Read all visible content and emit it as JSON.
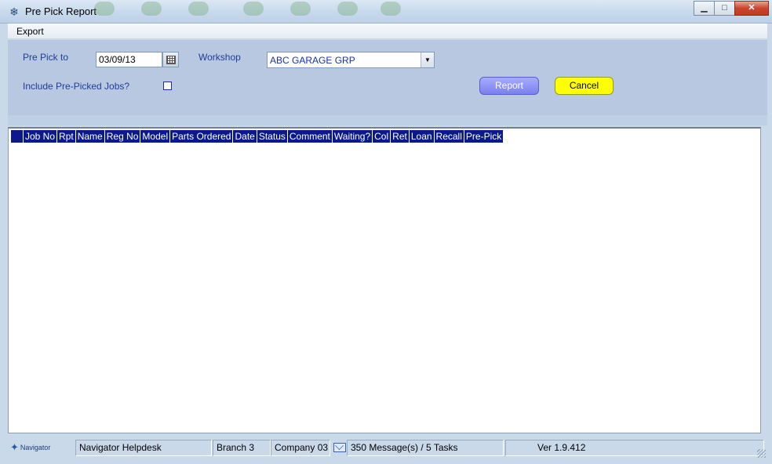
{
  "window": {
    "title": "Pre Pick Report",
    "app_icon": "snowflake-icon",
    "controls": {
      "minimize": "▁",
      "maximize": "□",
      "close": "✕"
    }
  },
  "menu": {
    "items": [
      {
        "label": "Export"
      }
    ]
  },
  "filters": {
    "pre_pick_label": "Pre Pick to",
    "pre_pick_date": "03/09/13",
    "workshop_label": "Workshop",
    "workshop_value": "ABC GARAGE GRP",
    "include_label": "Include Pre-Picked Jobs?",
    "include_checked": false,
    "report_label": "Report",
    "cancel_label": "Cancel"
  },
  "grid": {
    "columns": [
      "Job No",
      "Rpt",
      "Name",
      "Reg No",
      "Model",
      "Parts Ordered",
      "Date",
      "Status",
      "Comment",
      "Waiting?",
      "Col",
      "Ret",
      "Loan",
      "Recall",
      "Pre-Pick"
    ],
    "rows": []
  },
  "status_bar": {
    "logo_text": "Navigator",
    "helpdesk": "Navigator Helpdesk",
    "branch": "Branch 3",
    "company": "Company 03",
    "messages": "350 Message(s) / 5 Tasks",
    "version": "Ver 1.9.412"
  },
  "colors": {
    "panel": "#b8c8e0",
    "label_text": "#1f3c9c",
    "grid_header": "#0a1a8c",
    "report_button": "#7a80f0",
    "cancel_button": "#ffff00"
  }
}
